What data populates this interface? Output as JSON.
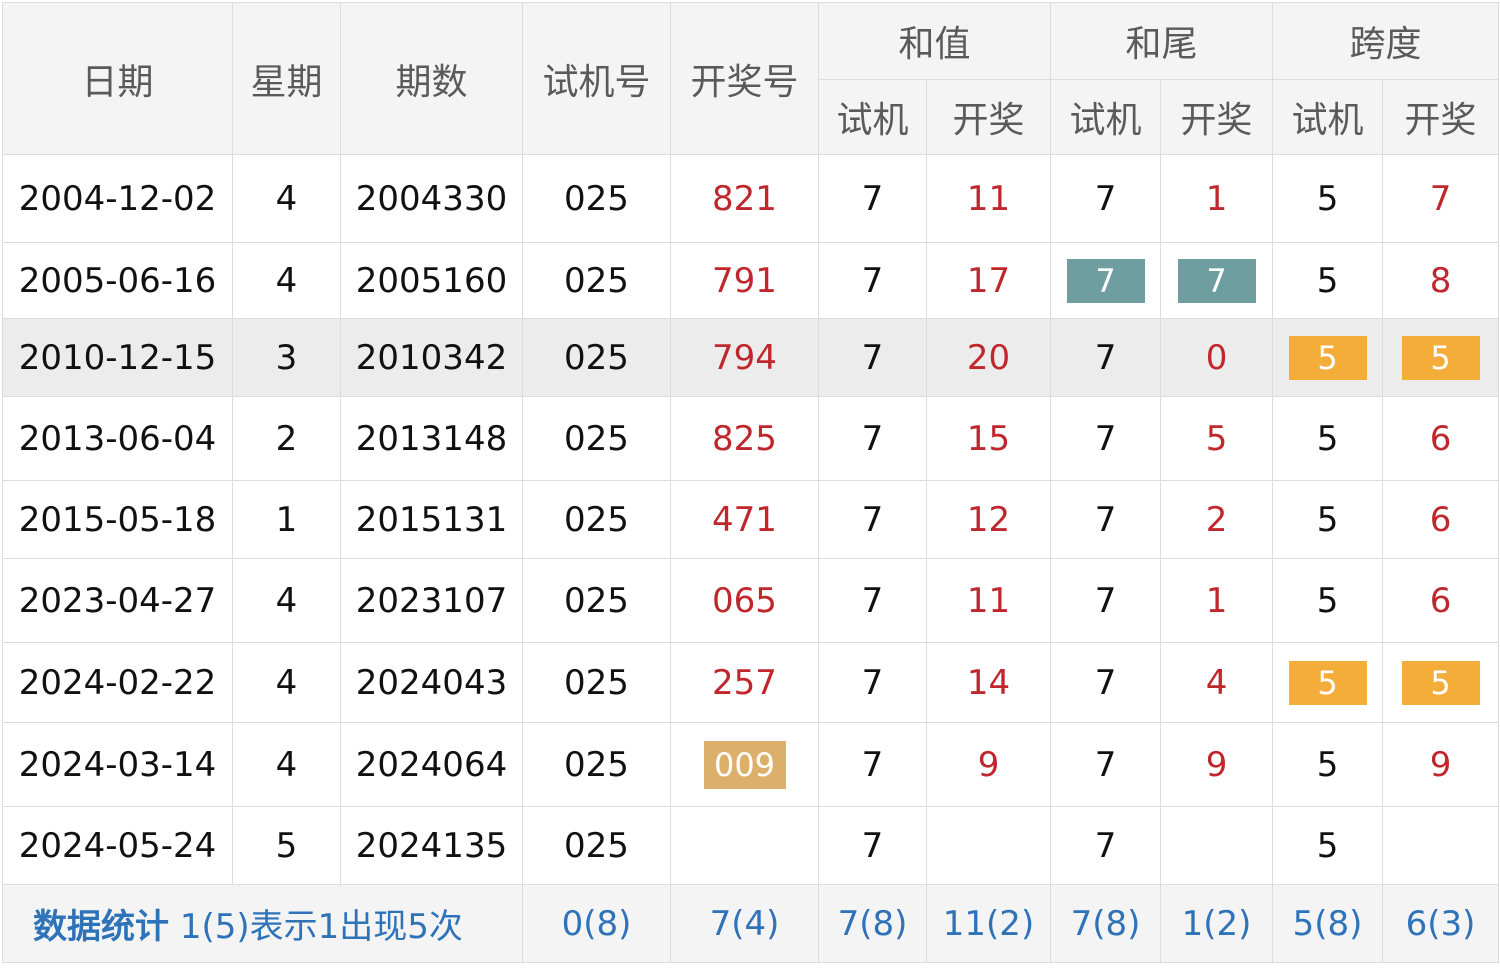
{
  "header": {
    "date": "日期",
    "weekday": "星期",
    "issue": "期数",
    "trial_number": "试机号",
    "draw_number": "开奖号",
    "sum_group": "和值",
    "tail_group": "和尾",
    "span_group": "跨度",
    "sub_trial": "试机",
    "sub_draw": "开奖"
  },
  "rows": [
    {
      "date": "2004-12-02",
      "weekday": "4",
      "issue": "2004330",
      "trial": "025",
      "draw": "821",
      "sum_trial": "7",
      "sum_draw": "11",
      "tail_trial": "7",
      "tail_draw": "1",
      "span_trial": "5",
      "span_draw": "7"
    },
    {
      "date": "2005-06-16",
      "weekday": "4",
      "issue": "2005160",
      "trial": "025",
      "draw": "791",
      "sum_trial": "7",
      "sum_draw": "17",
      "tail_trial": "7",
      "tail_draw": "7",
      "span_trial": "5",
      "span_draw": "8"
    },
    {
      "date": "2010-12-15",
      "weekday": "3",
      "issue": "2010342",
      "trial": "025",
      "draw": "794",
      "sum_trial": "7",
      "sum_draw": "20",
      "tail_trial": "7",
      "tail_draw": "0",
      "span_trial": "5",
      "span_draw": "5"
    },
    {
      "date": "2013-06-04",
      "weekday": "2",
      "issue": "2013148",
      "trial": "025",
      "draw": "825",
      "sum_trial": "7",
      "sum_draw": "15",
      "tail_trial": "7",
      "tail_draw": "5",
      "span_trial": "5",
      "span_draw": "6"
    },
    {
      "date": "2015-05-18",
      "weekday": "1",
      "issue": "2015131",
      "trial": "025",
      "draw": "471",
      "sum_trial": "7",
      "sum_draw": "12",
      "tail_trial": "7",
      "tail_draw": "2",
      "span_trial": "5",
      "span_draw": "6"
    },
    {
      "date": "2023-04-27",
      "weekday": "4",
      "issue": "2023107",
      "trial": "025",
      "draw": "065",
      "sum_trial": "7",
      "sum_draw": "11",
      "tail_trial": "7",
      "tail_draw": "1",
      "span_trial": "5",
      "span_draw": "6"
    },
    {
      "date": "2024-02-22",
      "weekday": "4",
      "issue": "2024043",
      "trial": "025",
      "draw": "257",
      "sum_trial": "7",
      "sum_draw": "14",
      "tail_trial": "7",
      "tail_draw": "4",
      "span_trial": "5",
      "span_draw": "5"
    },
    {
      "date": "2024-03-14",
      "weekday": "4",
      "issue": "2024064",
      "trial": "025",
      "draw": "009",
      "sum_trial": "7",
      "sum_draw": "9",
      "tail_trial": "7",
      "tail_draw": "9",
      "span_trial": "5",
      "span_draw": "9"
    },
    {
      "date": "2024-05-24",
      "weekday": "5",
      "issue": "2024135",
      "trial": "025",
      "draw": "",
      "sum_trial": "7",
      "sum_draw": "",
      "tail_trial": "7",
      "tail_draw": "",
      "span_trial": "5",
      "span_draw": ""
    }
  ],
  "stats": {
    "label": "数据统计",
    "note": "1(5)表示1出现5次",
    "trial": "0(8)",
    "draw": "7(4)",
    "sum_trial": "7(8)",
    "sum_draw": "11(2)",
    "tail_trial": "7(8)",
    "tail_draw": "1(2)",
    "span_trial": "5(8)",
    "span_draw": "6(3)"
  },
  "colors": {
    "draw_text": "#c0272d",
    "badge_teal": "#6e9ea0",
    "badge_orange": "#f5ad3a",
    "badge_tan": "#dcb06a",
    "stat_text": "#2e72b8"
  }
}
